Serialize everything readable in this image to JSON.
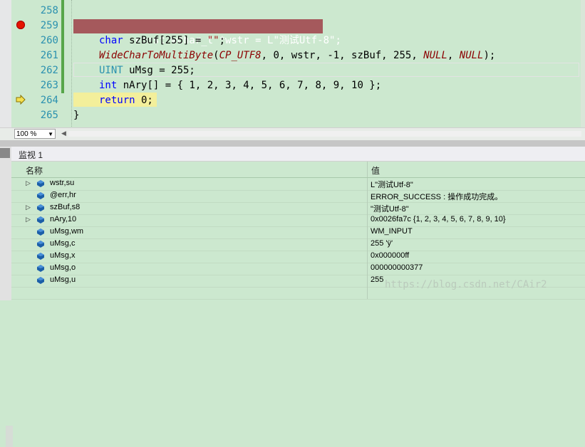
{
  "editor": {
    "lines": [
      {
        "num": "258",
        "text": ""
      },
      {
        "num": "259",
        "text": "const wchar_t *wstr = L\"测试Utf-8\";"
      },
      {
        "num": "260",
        "text_parts": {
          "kw": "char",
          "rest": " szBuf[255] = ",
          "str": "\"\"",
          "end": ";"
        }
      },
      {
        "num": "261",
        "text_parts": {
          "fn": "WideCharToMultiByte",
          "p1": "(",
          "mac1": "CP_UTF8",
          "p2": ", 0, wstr, -1, szBuf, 255, ",
          "mac2": "NULL",
          "p3": ", ",
          "mac3": "NULL",
          "p4": ");"
        }
      },
      {
        "num": "262",
        "text_parts": {
          "ty": "UINT",
          "rest": " uMsg = 255;"
        }
      },
      {
        "num": "263",
        "text_parts": {
          "kw": "int",
          "rest": " nAry[] = { 1, 2, 3, 4, 5, 6, 7, 8, 9, 10 };"
        }
      },
      {
        "num": "264",
        "text_parts": {
          "kw": "return",
          "rest": " 0;"
        }
      },
      {
        "num": "265",
        "text": "}"
      }
    ]
  },
  "zoom": {
    "value": "100 %"
  },
  "watch": {
    "title": "监视 1",
    "col_name": "名称",
    "col_value": "值",
    "rows": [
      {
        "name": "wstr,su",
        "value": "L\"测试Utf-8\"",
        "expandable": true
      },
      {
        "name": "@err,hr",
        "value": "ERROR_SUCCESS : 操作成功完成。",
        "expandable": false
      },
      {
        "name": "szBuf,s8",
        "value": "\"测试Utf-8\"",
        "expandable": true
      },
      {
        "name": "nAry,10",
        "value": "0x0026fa7c {1, 2, 3, 4, 5, 6, 7, 8, 9, 10}",
        "expandable": true
      },
      {
        "name": "uMsg,wm",
        "value": "WM_INPUT",
        "expandable": false
      },
      {
        "name": "uMsg,c",
        "value": "255 'ÿ'",
        "expandable": false
      },
      {
        "name": "uMsg,x",
        "value": "0x000000ff",
        "expandable": false
      },
      {
        "name": "uMsg,o",
        "value": "000000000377",
        "expandable": false
      },
      {
        "name": "uMsg,u",
        "value": "255",
        "expandable": false
      }
    ]
  },
  "watermark": "https://blog.csdn.net/CAir2",
  "colors": {
    "background": "#cce8cf",
    "breakpoint_line": "#a5595c",
    "current_line": "#f3ef9b",
    "keyword": "#0000ff",
    "type": "#2b91af",
    "function": "#8b0000",
    "string": "#a31515"
  }
}
